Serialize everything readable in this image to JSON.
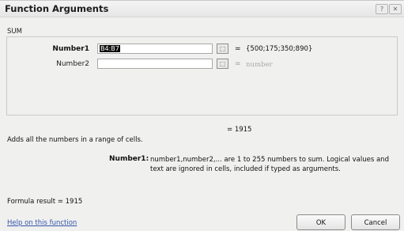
{
  "dialog": {
    "title": "Function Arguments",
    "help_button": "?",
    "close_button": "✕"
  },
  "function_name": "SUM",
  "arguments": [
    {
      "label": "Number1",
      "value": "B4:B7",
      "result": "{500;175;350;890}"
    },
    {
      "label": "Number2",
      "value": "",
      "result": "number"
    }
  ],
  "equals": "=",
  "ref_button_glyph": "⬚",
  "result_line": "= 1915",
  "description": "Adds all the numbers in a range of cells.",
  "arg_help": {
    "label": "Number1:",
    "text": "number1,number2,... are 1 to 255 numbers to sum. Logical values and text are ignored in cells, included if typed as arguments."
  },
  "formula_result": "Formula result = 1915",
  "help_link": "Help on this function",
  "buttons": {
    "ok": "OK",
    "cancel": "Cancel"
  }
}
